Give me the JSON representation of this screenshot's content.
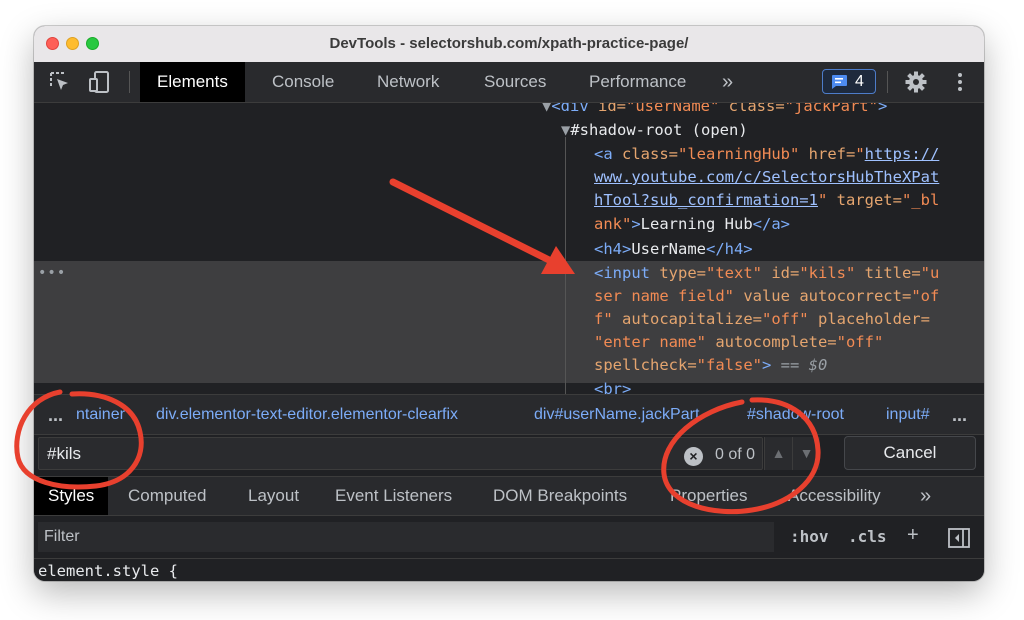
{
  "window": {
    "title": "DevTools - selectorshub.com/xpath-practice-page/"
  },
  "toolbar": {
    "inspect_icon": "inspect-element-icon",
    "device_icon": "device-toolbar-icon",
    "tabs": [
      "Elements",
      "Console",
      "Network",
      "Sources",
      "Performance"
    ],
    "active_tab": "Elements",
    "more_tabs": "»",
    "issues_count": "4",
    "settings_icon": "gear-icon",
    "menu_icon": "kebab-menu-icon"
  },
  "dom_tree": {
    "line_div": {
      "prefix": "▼",
      "tag_open": "<div",
      "id_attr": " id=",
      "id_val": "\"userName\"",
      "class_attr": " class=",
      "class_val": "\"jackPart\"",
      "tag_close": ">"
    },
    "line_shadow": {
      "prefix": "▼",
      "text": "#shadow-root (open)"
    },
    "anchor": {
      "l1_tag": "<a",
      "l1_attr": " class=",
      "l1_val": "\"learningHub\"",
      "l1_attr2": " href=",
      "l1_quote": "\"",
      "l1_link": "https://",
      "l2_link": "www.youtube.com/c/SelectorsHubTheXPat",
      "l3_link": "hTool?sub_confirmation=1",
      "l3_quote": "\"",
      "l3_attr": " target=",
      "l3_val": "\"_bl",
      "l4_val": "ank\"",
      "l4_tag": ">",
      "l4_text": "Learning Hub",
      "l4_close": "</a>"
    },
    "h4": {
      "open": "<h4>",
      "text": "UserName",
      "close": "</h4>"
    },
    "input": {
      "l1_tag": "<input",
      "l1_a1": " type=",
      "l1_v1": "\"text\"",
      "l1_a2": " id=",
      "l1_v2": "\"kils\"",
      "l1_a3": " title=",
      "l1_v3": "\"u",
      "l2_v": "ser name field\"",
      "l2_a1": " value",
      "l2_a2": " autocorrect=",
      "l2_v2": "\"of",
      "l3_v": "f\"",
      "l3_a1": " autocapitalize=",
      "l3_v1": "\"off\"",
      "l3_a2": " placeholder=",
      "l4_v": "\"enter name\"",
      "l4_a1": " autocomplete=",
      "l4_v1": "\"off\"",
      "l5_a": "spellcheck=",
      "l5_v": "\"false\"",
      "l5_close": ">",
      "l5_eq": " == ",
      "l5_ref": "$0"
    },
    "br": "<br>",
    "gutter_dots": "•••"
  },
  "breadcrumbs": {
    "more": "...",
    "items": [
      "ntainer",
      "div.elementor-text-editor.elementor-clearfix",
      "div#userName.jackPart",
      "#shadow-root",
      "input#"
    ],
    "trailing": "..."
  },
  "search": {
    "query": "#kils",
    "match_count": "0 of 0",
    "prev_icon": "chevron-up-icon",
    "next_icon": "chevron-down-icon",
    "cancel_label": "Cancel"
  },
  "panel_tabs": {
    "items": [
      "Styles",
      "Computed",
      "Layout",
      "Event Listeners",
      "DOM Breakpoints",
      "Properties",
      "Accessibility"
    ],
    "active": "Styles",
    "more": "»"
  },
  "styles": {
    "filter_placeholder": "Filter",
    "hov": ":hov",
    "cls": ".cls",
    "add": "+",
    "toggle_sidebar_icon": "sidebar-toggle-icon",
    "element_style": "element.style {"
  },
  "annotations": {
    "arrow_color": "#e8402e",
    "circle_color": "#e8402e"
  }
}
